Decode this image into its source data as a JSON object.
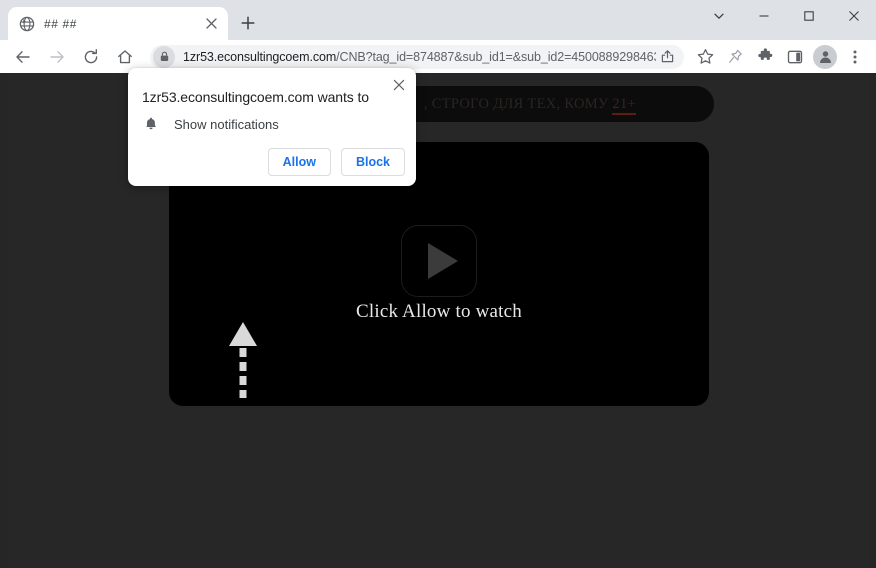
{
  "window": {
    "controls": {
      "tab_search_label": "tab-search",
      "minimize_label": "minimize",
      "maximize_label": "maximize",
      "close_label": "close"
    }
  },
  "tabstrip": {
    "tabs": [
      {
        "title": "## ##",
        "favicon": "globe-icon",
        "close_label": "close-tab"
      }
    ],
    "new_tab_label": "new-tab"
  },
  "toolbar": {
    "back_label": "back",
    "forward_label": "forward",
    "reload_label": "reload",
    "home_label": "home",
    "omnibox": {
      "lock_icon": "lock-icon",
      "host": "1zr53.econsultingcoem.com",
      "path": "/CNB?tag_id=874887&sub_id1=&sub_id2=45008892984631...",
      "full_url": "1zr53.econsultingcoem.com/CNB?tag_id=874887&sub_id1=&sub_id2=45008892984631...",
      "share_label": "share"
    },
    "bookmark_label": "bookmark-star",
    "pin_label": "pin-cursor",
    "extensions_label": "extensions-puzzle",
    "sidepanel_label": "side-panel",
    "profile_label": "profile-avatar",
    "menu_label": "chrome-menu"
  },
  "permission_dialog": {
    "title": "1zr53.econsultingcoem.com wants to",
    "permission_icon": "bell-icon",
    "permission_label": "Show notifications",
    "allow_label": "Allow",
    "block_label": "Block",
    "close_label": "close-dialog",
    "accent_color": "#1a73e8"
  },
  "page_content": {
    "background_color": "#262626",
    "banner": {
      "text_prefix": ", СТРОГО ДЛЯ ТЕХ, КОМУ ",
      "age_text": "21+",
      "full_text": ", СТРОГО ДЛЯ ТЕХ, КОМУ 21+",
      "underline_color": "#5d1d14"
    },
    "video": {
      "play_icon": "play-button-icon",
      "call_to_action": "Click Allow to watch",
      "background_color": "#000000"
    },
    "arrow": {
      "icon": "up-arrow-dashed-icon",
      "color": "#d9d9d9"
    }
  }
}
